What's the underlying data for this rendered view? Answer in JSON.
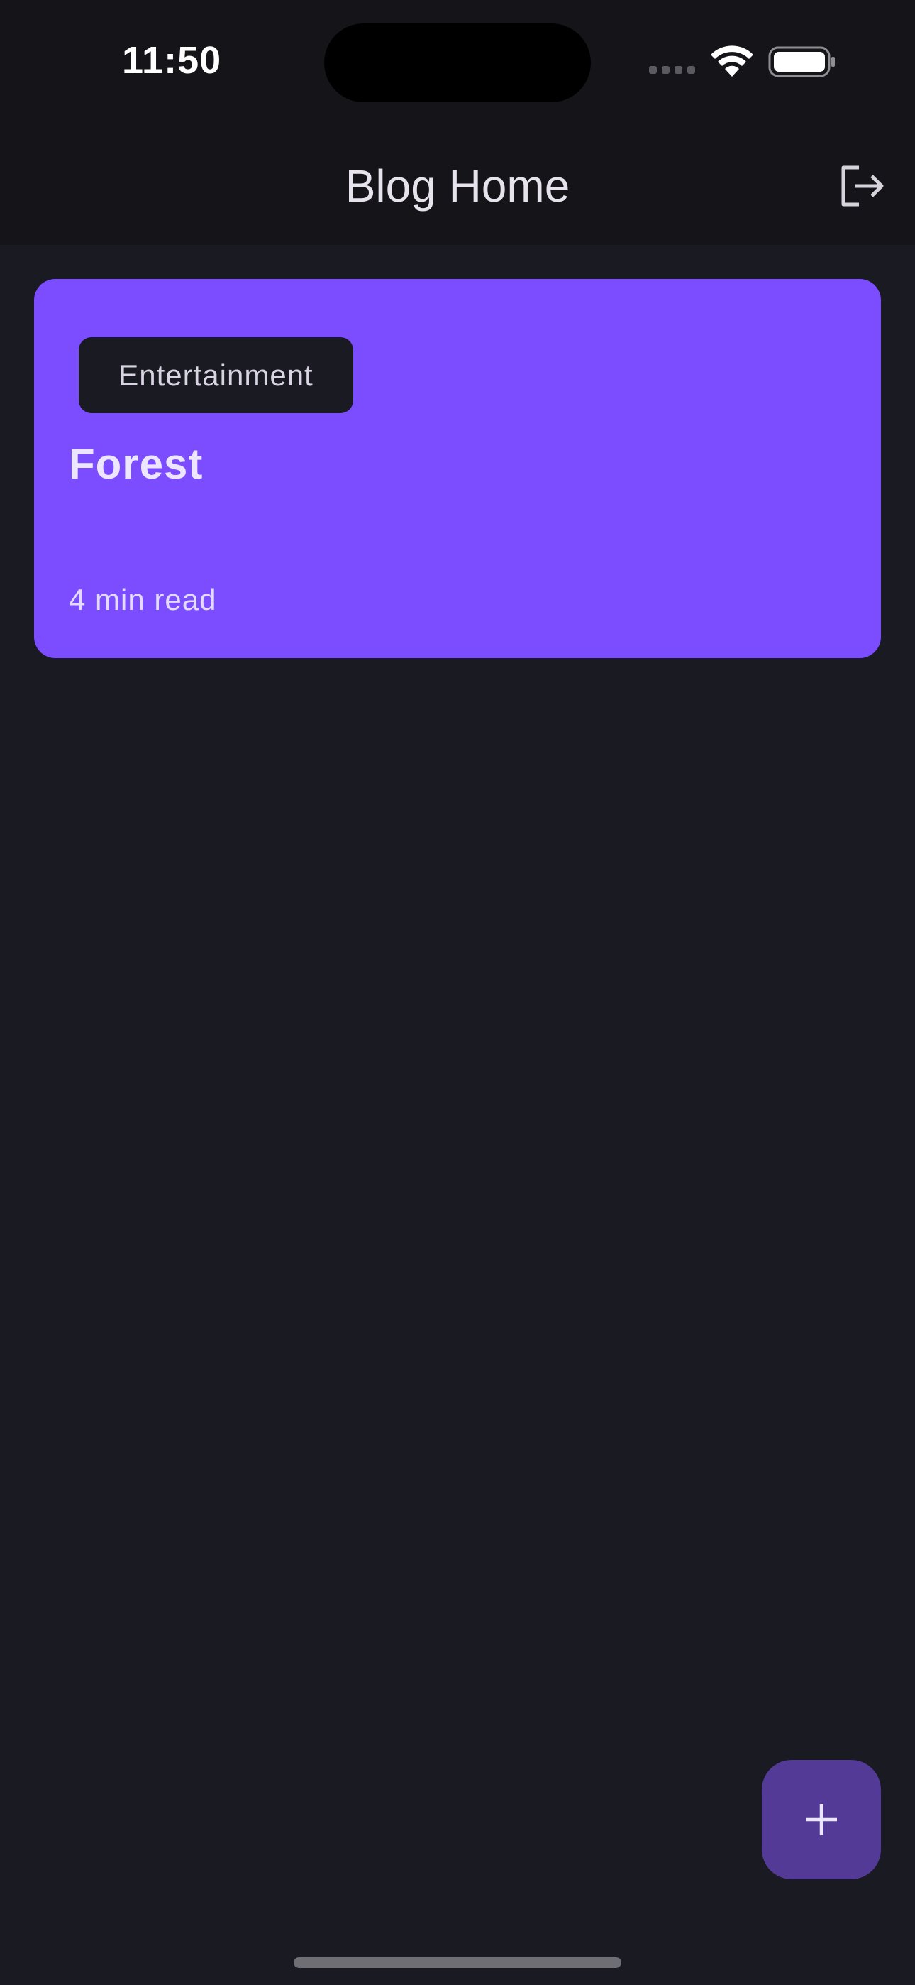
{
  "status_bar": {
    "time": "11:50"
  },
  "app_bar": {
    "title": "Blog Home",
    "logout_icon": "logout-icon"
  },
  "posts": [
    {
      "category": "Entertainment",
      "title": "Forest",
      "read_time": "4 min read"
    }
  ],
  "fab": {
    "icon": "plus-icon"
  },
  "colors": {
    "background": "#1a1a22",
    "topbar": "#141419",
    "card": "#7c4dff",
    "chip": "#1a1a22",
    "fab": "#523a96"
  }
}
